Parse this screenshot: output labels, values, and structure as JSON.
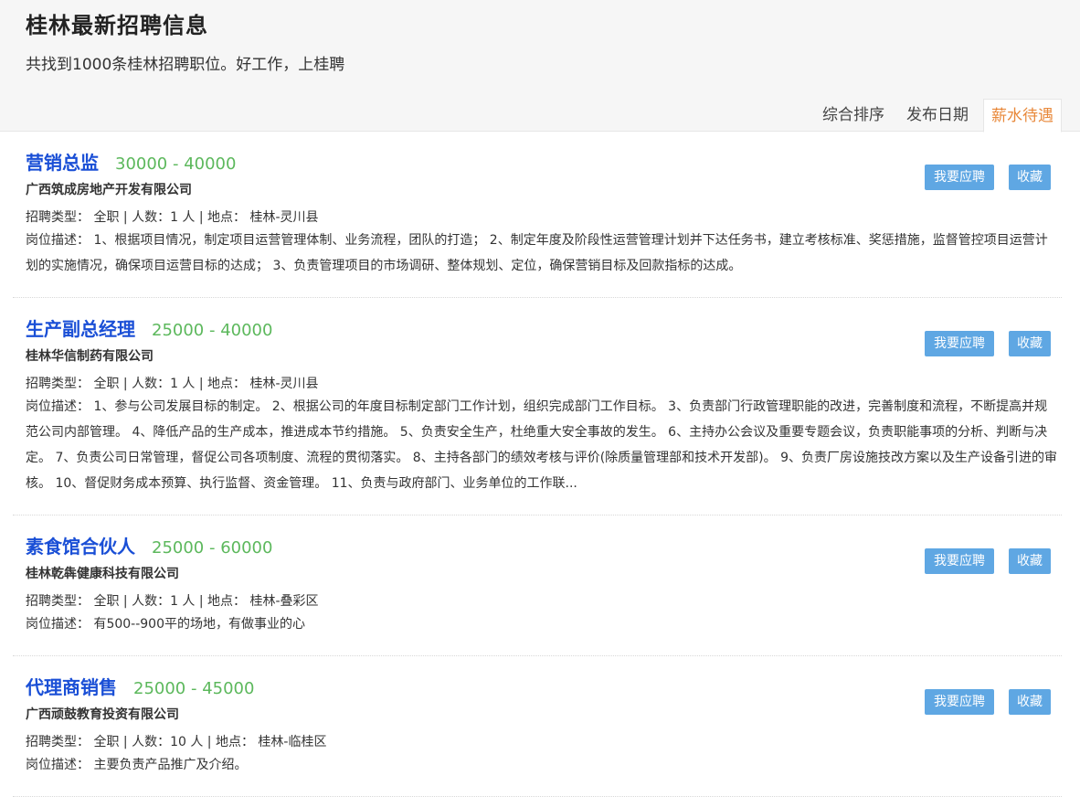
{
  "header": {
    "title": "桂林最新招聘信息",
    "subtitle": "共找到1000条桂林招聘职位。好工作，上桂聘"
  },
  "sort_tabs": [
    {
      "label": "综合排序",
      "active": false
    },
    {
      "label": "发布日期",
      "active": false
    },
    {
      "label": "薪水待遇",
      "active": true
    }
  ],
  "actions": {
    "apply_label": "我要应聘",
    "favorite_label": "收藏"
  },
  "jobs": [
    {
      "title": "营销总监",
      "salary": "30000 - 40000",
      "company": "广西筑成房地产开发有限公司",
      "meta": "招聘类型： 全职 | 人数：1 人 | 地点： 桂林-灵川县",
      "desc": "岗位描述： 1、根据项目情况，制定项目运营管理体制、业务流程，团队的打造； 2、制定年度及阶段性运营管理计划并下达任务书，建立考核标准、奖惩措施，监督管控项目运营计划的实施情况，确保项目运营目标的达成； 3、负责管理项目的市场调研、整体规划、定位，确保营销目标及回款指标的达成。"
    },
    {
      "title": "生产副总经理",
      "salary": "25000 - 40000",
      "company": "桂林华信制药有限公司",
      "meta": "招聘类型： 全职 | 人数：1 人 | 地点： 桂林-灵川县",
      "desc": "岗位描述： 1、参与公司发展目标的制定。 2、根据公司的年度目标制定部门工作计划，组织完成部门工作目标。 3、负责部门行政管理职能的改进，完善制度和流程，不断提高并规范公司内部管理。 4、降低产品的生产成本，推进成本节约措施。 5、负责安全生产，杜绝重大安全事故的发生。 6、主持办公会议及重要专题会议，负责职能事项的分析、判断与决定。 7、负责公司日常管理，督促公司各项制度、流程的贯彻落实。 8、主持各部门的绩效考核与评价(除质量管理部和技术开发部)。 9、负责厂房设施技改方案以及生产设备引进的审核。 10、督促财务成本预算、执行监督、资金管理。 11、负责与政府部门、业务单位的工作联..."
    },
    {
      "title": "素食馆合伙人",
      "salary": "25000 - 60000",
      "company": "桂林乾犇健康科技有限公司",
      "meta": "招聘类型： 全职 | 人数：1 人 | 地点： 桂林-叠彩区",
      "desc": "岗位描述： 有500--900平的场地，有做事业的心"
    },
    {
      "title": "代理商销售",
      "salary": "25000 - 45000",
      "company": "广西顽鼓教育投资有限公司",
      "meta": "招聘类型： 全职 | 人数：10 人 | 地点： 桂林-临桂区",
      "desc": "岗位描述： 主要负责产品推广及介绍。"
    }
  ]
}
